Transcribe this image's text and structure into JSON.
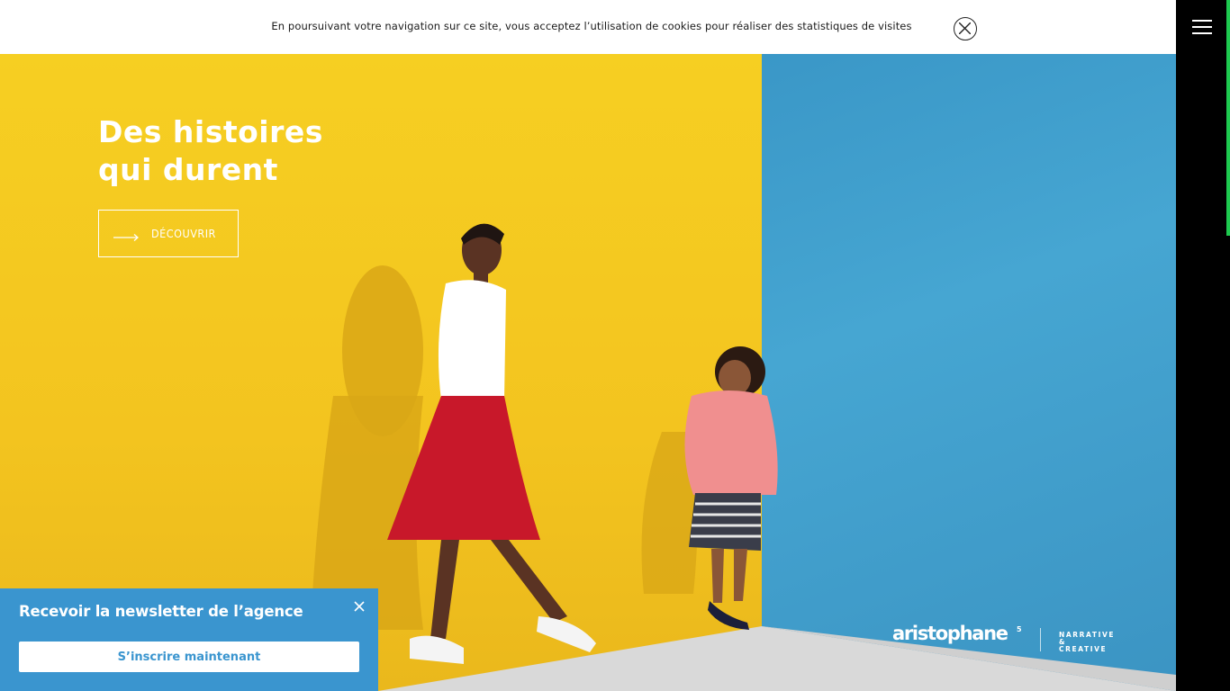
{
  "cookie_bar": {
    "message": "En poursuivant votre navigation sur ce site, vous acceptez l’utilisation de cookies pour réaliser des statistiques de visites",
    "close_icon": "close-circle-icon"
  },
  "menu": {
    "icon": "hamburger-menu-icon"
  },
  "hero": {
    "title_line1": "Des histoires",
    "title_line2": "qui durent",
    "cta_label": "DÉCOUVRIR",
    "cta_icon": "arrow-right-icon"
  },
  "logo": {
    "wordmark": "aristophane",
    "superscript": "5",
    "tagline_line1": "NARRATIVE",
    "tagline_line2": "& CREATIVE"
  },
  "newsletter": {
    "title": "Recevoir la newsletter de l’agence",
    "button_label": "S’inscrire maintenant",
    "close_icon": "close-icon"
  },
  "colors": {
    "accent_green": "#1ec94f",
    "wall_yellow": "#f5c922",
    "wall_blue": "#3f9ccb",
    "newsletter_blue": "#3a95cf"
  }
}
